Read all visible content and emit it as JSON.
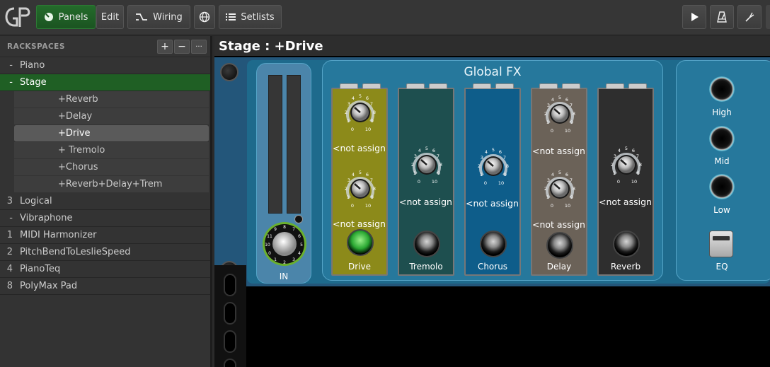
{
  "toolbar": {
    "logo": "GP",
    "panels_label": "Panels",
    "edit_label": "Edit",
    "wiring_label": "Wiring",
    "setlists_label": "Setlists"
  },
  "rackspaces": {
    "header": "RACKSPACES",
    "add_label": "+",
    "remove_label": "−",
    "more_label": "···",
    "items": [
      {
        "num": "-",
        "name": "Piano"
      },
      {
        "num": "-",
        "name": "Stage"
      },
      {
        "num": "3",
        "name": "Logical"
      },
      {
        "num": "-",
        "name": "Vibraphone"
      },
      {
        "num": "1",
        "name": "MIDI Harmonizer"
      },
      {
        "num": "2",
        "name": "PitchBendToLeslieSpeed"
      },
      {
        "num": "4",
        "name": "PianoTeq"
      },
      {
        "num": "8",
        "name": "PolyMax Pad"
      }
    ],
    "variations": [
      "+Reverb",
      "+Delay",
      "+Drive",
      "+ Tremolo",
      "+Chorus",
      "+Reverb+Delay+Trem"
    ]
  },
  "main": {
    "title": "Stage : +Drive",
    "in_label": "IN",
    "global_fx_title": "Global FX",
    "not_assigned": "<not assign...",
    "fx": [
      {
        "name": "Drive",
        "color": "#8c8a1a"
      },
      {
        "name": "Tremolo",
        "color": "#1e4f4f"
      },
      {
        "name": "Chorus",
        "color": "#0e5d8a"
      },
      {
        "name": "Delay",
        "color": "#6b6258"
      },
      {
        "name": "Reverb",
        "color": "#2e2e2e"
      }
    ],
    "eq": {
      "high": "High",
      "mid": "Mid",
      "low": "Low",
      "eq": "EQ"
    }
  }
}
